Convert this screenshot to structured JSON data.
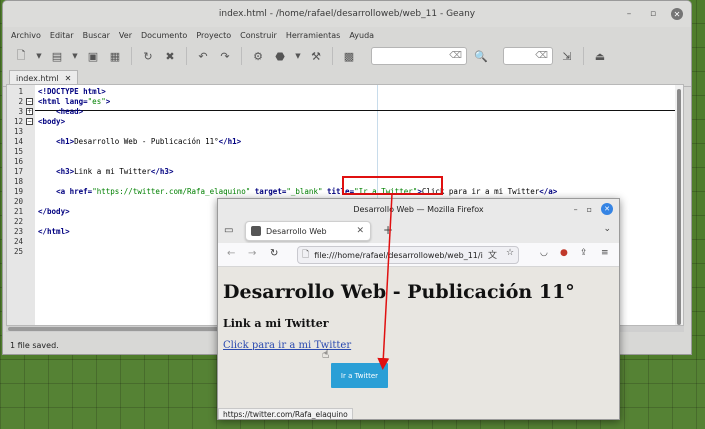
{
  "geany": {
    "title": "index.html - /home/rafael/desarrolloweb/web_11 - Geany",
    "menu": [
      "Archivo",
      "Editar",
      "Buscar",
      "Ver",
      "Documento",
      "Proyecto",
      "Construir",
      "Herramientas",
      "Ayuda"
    ],
    "tab_label": "index.html",
    "status": "1 file saved.",
    "lines": [
      {
        "n": "1",
        "segs": [
          [
            "t",
            "<!DOCTYPE html>"
          ]
        ]
      },
      {
        "n": "2",
        "segs": [
          [
            "t",
            "<html lang="
          ],
          [
            "s",
            "\"es\""
          ],
          [
            "t",
            ">"
          ]
        ]
      },
      {
        "n": "3",
        "segs": [
          [
            "p",
            "    "
          ],
          [
            "t",
            "<head>"
          ]
        ]
      },
      {
        "n": "12",
        "segs": [
          [
            "t",
            "<body"
          ],
          [
            "t",
            ">"
          ]
        ]
      },
      {
        "n": "13",
        "segs": []
      },
      {
        "n": "14",
        "segs": [
          [
            "p",
            "    "
          ],
          [
            "t",
            "<h1>"
          ],
          [
            "p",
            "Desarrollo Web - Publicación 11°"
          ],
          [
            "t",
            "</h1>"
          ]
        ]
      },
      {
        "n": "15",
        "segs": []
      },
      {
        "n": "16",
        "segs": []
      },
      {
        "n": "17",
        "segs": [
          [
            "p",
            "    "
          ],
          [
            "t",
            "<h3>"
          ],
          [
            "p",
            "Link a mi Twitter"
          ],
          [
            "t",
            "</h3>"
          ]
        ]
      },
      {
        "n": "18",
        "segs": []
      },
      {
        "n": "19",
        "segs": [
          [
            "p",
            "    "
          ],
          [
            "t",
            "<a href="
          ],
          [
            "s",
            "\"https://twitter.com/Rafa_elaquino\""
          ],
          [
            "t",
            " target="
          ],
          [
            "s",
            "\"_blank\""
          ],
          [
            "t",
            " title="
          ],
          [
            "s",
            "\"Ir a Twitter\""
          ],
          [
            "t",
            ">"
          ],
          [
            "p",
            "Click para ir a mi Twitter"
          ],
          [
            "t",
            "</a>"
          ]
        ]
      },
      {
        "n": "20",
        "segs": []
      },
      {
        "n": "21",
        "segs": [
          [
            "t",
            "</body>"
          ]
        ]
      },
      {
        "n": "22",
        "segs": []
      },
      {
        "n": "23",
        "segs": [
          [
            "t",
            "</html>"
          ]
        ]
      },
      {
        "n": "24",
        "segs": []
      },
      {
        "n": "25",
        "segs": []
      }
    ]
  },
  "firefox": {
    "title": "Desarrollo Web — Mozilla Firefox",
    "tab_title": "Desarrollo Web",
    "url": "file:///home/rafael/desarrolloweb/web_11/i",
    "page": {
      "h1": "Desarrollo Web - Publicación 11°",
      "h3": "Link a mi Twitter",
      "link": "Click para ir a mi Twitter",
      "tooltip": "Ir a Twitter"
    },
    "status_url": "https://twitter.com/Rafa_elaquino"
  },
  "colors": {
    "tag": "#000080",
    "string": "#008000",
    "annotation": "#e01010",
    "tooltip": "#2a9fd6"
  }
}
